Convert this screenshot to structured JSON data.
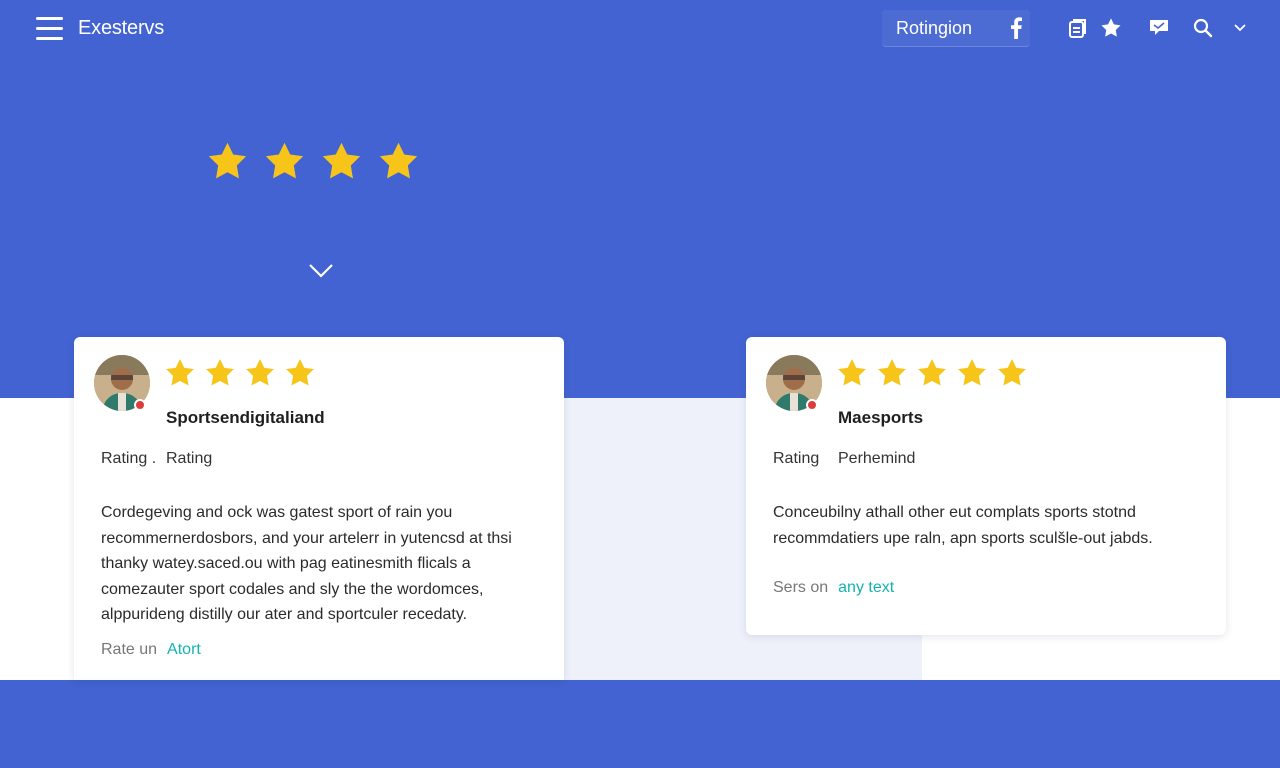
{
  "colors": {
    "brand_blue": "#4263d1",
    "star": "#f7c51a",
    "link": "#14b3b3",
    "pale_panel": "#eef1fa"
  },
  "header": {
    "menu_icon": "hamburger-icon",
    "app_title": "Exestervs",
    "nav_item": "Rotingion",
    "icons": [
      "facebook-icon",
      "clipboard-icon",
      "star-icon",
      "chat-icon",
      "search-icon",
      "chevron-down-icon"
    ]
  },
  "hero": {
    "stars": 4,
    "scroll_icon": "chevron-down-icon"
  },
  "reviews": [
    {
      "stars": 4,
      "name": "Sportsendigitaliand",
      "rating_label": "Rating .",
      "rating_value": "Rating",
      "lines": [
        "Cordegeving and ock was gatest sport of rain you",
        "recommernerdosbors, and your artelerr in yutencsd at thsi",
        "thanky watey.saced.ou with pag eatinesmith flicals a",
        "comezauter sport codales and sly the the wordomces,",
        "alppurideng distilly our ater and sportculer recedaty."
      ],
      "footer_label": "Rate un",
      "footer_link": "Atort"
    },
    {
      "stars": 5,
      "name": "Maesports",
      "rating_label": "Rating",
      "rating_value": "Perhemind",
      "lines": [
        "Conceubilny athall other eut complats sports stotnd",
        "recommdatiers upe raln, apn sports sculšle-out jabds."
      ],
      "footer_label": "Sers on",
      "footer_link": "any text"
    }
  ]
}
